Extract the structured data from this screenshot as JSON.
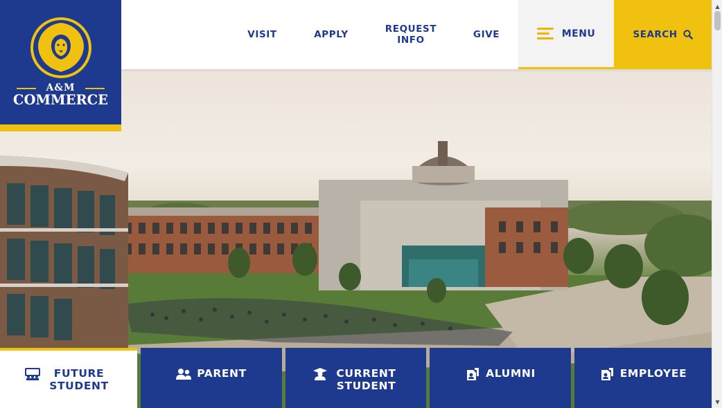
{
  "site": {
    "logo_line1": "A&M",
    "logo_line2": "COMMERCE"
  },
  "nav": {
    "visit": "VISIT",
    "apply": "APPLY",
    "request_info": "REQUEST INFO",
    "give": "GIVE",
    "menu": "MENU",
    "search": "SEARCH"
  },
  "audience_tabs": [
    {
      "label": "FUTURE STUDENT",
      "icon": "classroom-icon",
      "active": true
    },
    {
      "label": "PARENT",
      "icon": "users-icon",
      "active": false
    },
    {
      "label": "CURRENT STUDENT",
      "icon": "graduate-icon",
      "active": false
    },
    {
      "label": "ALUMNI",
      "icon": "alumni-icon",
      "active": false
    },
    {
      "label": "EMPLOYEE",
      "icon": "employee-icon",
      "active": false
    }
  ],
  "colors": {
    "brand_blue": "#1d3a8f",
    "brand_gold": "#f0c20f"
  }
}
